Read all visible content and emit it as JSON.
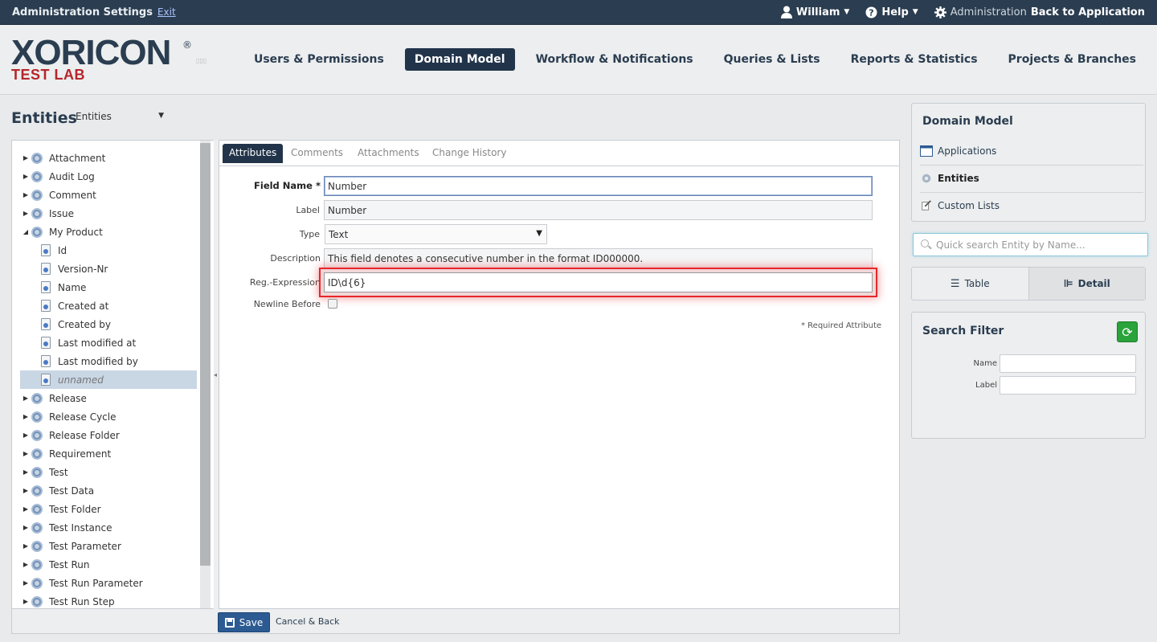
{
  "topbar": {
    "title": "Administration Settings",
    "exit": "Exit",
    "user": "William",
    "help": "Help",
    "admin_prefix": "Administration",
    "back": "Back to Application"
  },
  "logo": {
    "main": "XORICON",
    "registered": "®",
    "sub": "TEST LAB"
  },
  "nav": [
    {
      "label": "Users & Permissions",
      "active": false
    },
    {
      "label": "Domain Model",
      "active": true
    },
    {
      "label": "Workflow & Notifications",
      "active": false
    },
    {
      "label": "Queries & Lists",
      "active": false
    },
    {
      "label": "Reports & Statistics",
      "active": false
    },
    {
      "label": "Projects & Branches",
      "active": false
    }
  ],
  "page": {
    "title": "Entities",
    "selector_value": "Entities"
  },
  "tree": {
    "items": [
      {
        "label": "Attachment",
        "level": 0,
        "expanded": false
      },
      {
        "label": "Audit Log",
        "level": 0,
        "expanded": false
      },
      {
        "label": "Comment",
        "level": 0,
        "expanded": false
      },
      {
        "label": "Issue",
        "level": 0,
        "expanded": false
      },
      {
        "label": "My Product",
        "level": 0,
        "expanded": true
      },
      {
        "label": "Id",
        "level": 1
      },
      {
        "label": "Version-Nr",
        "level": 1
      },
      {
        "label": "Name",
        "level": 1
      },
      {
        "label": "Created at",
        "level": 1
      },
      {
        "label": "Created by",
        "level": 1
      },
      {
        "label": "Last modified at",
        "level": 1
      },
      {
        "label": "Last modified by",
        "level": 1
      },
      {
        "label": "unnamed",
        "level": 1,
        "selected": true
      },
      {
        "label": "Release",
        "level": 0,
        "expanded": false
      },
      {
        "label": "Release Cycle",
        "level": 0,
        "expanded": false
      },
      {
        "label": "Release Folder",
        "level": 0,
        "expanded": false
      },
      {
        "label": "Requirement",
        "level": 0,
        "expanded": false
      },
      {
        "label": "Test",
        "level": 0,
        "expanded": false
      },
      {
        "label": "Test Data",
        "level": 0,
        "expanded": false
      },
      {
        "label": "Test Folder",
        "level": 0,
        "expanded": false
      },
      {
        "label": "Test Instance",
        "level": 0,
        "expanded": false
      },
      {
        "label": "Test Parameter",
        "level": 0,
        "expanded": false
      },
      {
        "label": "Test Run",
        "level": 0,
        "expanded": false
      },
      {
        "label": "Test Run Parameter",
        "level": 0,
        "expanded": false
      },
      {
        "label": "Test Run Step",
        "level": 0,
        "expanded": false
      }
    ]
  },
  "tabs": [
    "Attributes",
    "Comments",
    "Attachments",
    "Change History"
  ],
  "form": {
    "field_name_label": "Field Name",
    "required_mark": "*",
    "field_name_value": "Number",
    "label_label": "Label",
    "label_value": "Number",
    "type_label": "Type",
    "type_value": "Text",
    "description_label": "Description",
    "description_value": "This field denotes a consecutive number in the format ID000000.",
    "regex_label": "Reg.-Expression",
    "regex_value": "ID\\d{6}",
    "newline_label": "Newline Before",
    "newline_checked": false,
    "required_note": "* Required Attribute"
  },
  "actions": {
    "save": "Save",
    "cancel": "Cancel & Back"
  },
  "sidebar": {
    "title": "Domain Model",
    "links": [
      {
        "label": "Applications",
        "icon": "window-icon",
        "active": false
      },
      {
        "label": "Entities",
        "icon": "gear-icon",
        "active": true
      },
      {
        "label": "Custom Lists",
        "icon": "wrench-icon",
        "active": false
      }
    ],
    "search_placeholder": "Quick search Entity by Name...",
    "view_table": "Table",
    "view_detail": "Detail",
    "filter_title": "Search Filter",
    "filter_name": "Name",
    "filter_label": "Label"
  },
  "colors": {
    "brand_dark": "#2b3d50",
    "brand_red": "#b5262a",
    "highlight": "#e6272b",
    "refresh_green": "#2aa33a"
  }
}
